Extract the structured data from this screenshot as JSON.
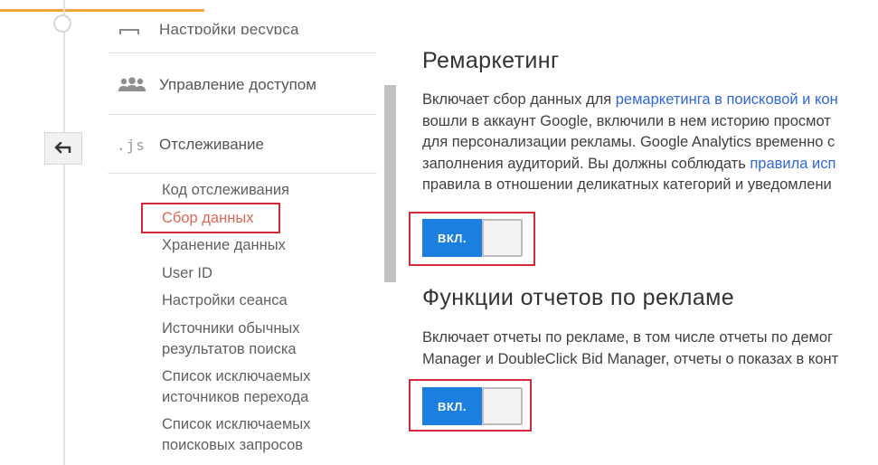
{
  "nav": {
    "partial_top_label": "Настройки ресурса",
    "items": [
      {
        "label": "Управление доступом",
        "icon": "users-icon"
      },
      {
        "label": "Отслеживание",
        "icon": "js-icon",
        "icon_text": ".js"
      }
    ],
    "tracking_subitems": [
      "Код отслеживания",
      "Сбор данных",
      "Хранение данных",
      "User ID",
      "Настройки сеанса",
      "Источники обычных результатов поиска",
      "Список исключаемых источников перехода",
      "Список исключаемых поисковых запросов"
    ],
    "tracking_subitems_lines": [
      [
        "Код отслеживания"
      ],
      [
        "Сбор данных"
      ],
      [
        "Хранение данных"
      ],
      [
        "User ID"
      ],
      [
        "Настройки сеанса"
      ],
      [
        "Источники обычных",
        "результатов поиска"
      ],
      [
        "Список исключаемых",
        "источников перехода"
      ],
      [
        "Список исключаемых",
        "поисковых запросов"
      ]
    ],
    "active_subitem": "Сбор данных"
  },
  "remarketing": {
    "title": "Ремаркетинг",
    "line1_text": "Включает сбор данных для ",
    "line1_link": "ремаркетинга в поисковой и кон",
    "line2": "вошли в аккаунт Google, включили в нем историю просмот",
    "line3": "для персонализации рекламы. Google Analytics временно с",
    "line4_text": "заполнения аудиторий. Вы должны соблюдать ",
    "line4_link": "правила исп",
    "line5": "правила в отношении деликатных категорий и уведомлени",
    "toggle_label": "ВКЛ.",
    "toggle_state": "on"
  },
  "ad_reporting": {
    "title": "Функции отчетов по рекламе",
    "line1": "Включает отчеты по рекламе, в том числе отчеты по демог",
    "line2": "Manager и DoubleClick Bid Manager, отчеты о показах в конт",
    "toggle_label": "ВКЛ.",
    "toggle_state": "on"
  },
  "colors": {
    "accent": "#f0a43c",
    "toggle_on": "#1b7fe0",
    "highlight": "#d22a3b",
    "link": "#3367d6",
    "active_item": "#d66a59"
  }
}
